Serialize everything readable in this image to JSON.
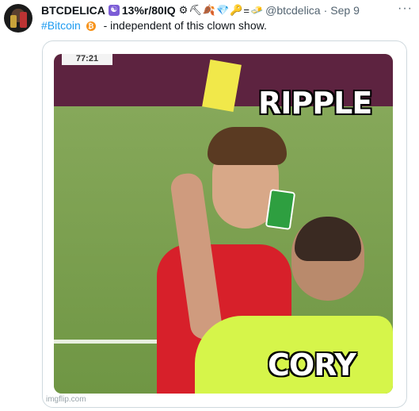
{
  "tweet": {
    "display_name": "BTCDELICA",
    "badge": "☯",
    "iq_text": "13%r/80IQ",
    "emojis": [
      "⚙",
      "⛏",
      "🍂",
      "💎",
      "🔑",
      "=",
      "🧈"
    ],
    "handle": "@btcdelica",
    "separator": "·",
    "date": "Sep 9",
    "more": "···",
    "hashtag": "#Bitcoin",
    "bitcoin_icon": "₿",
    "body": "-  independent of this clown show."
  },
  "media": {
    "scoreboard": "77:21",
    "top_caption": "RIPPLE",
    "bottom_caption": "CORY",
    "watermark": "imgflip.com"
  }
}
